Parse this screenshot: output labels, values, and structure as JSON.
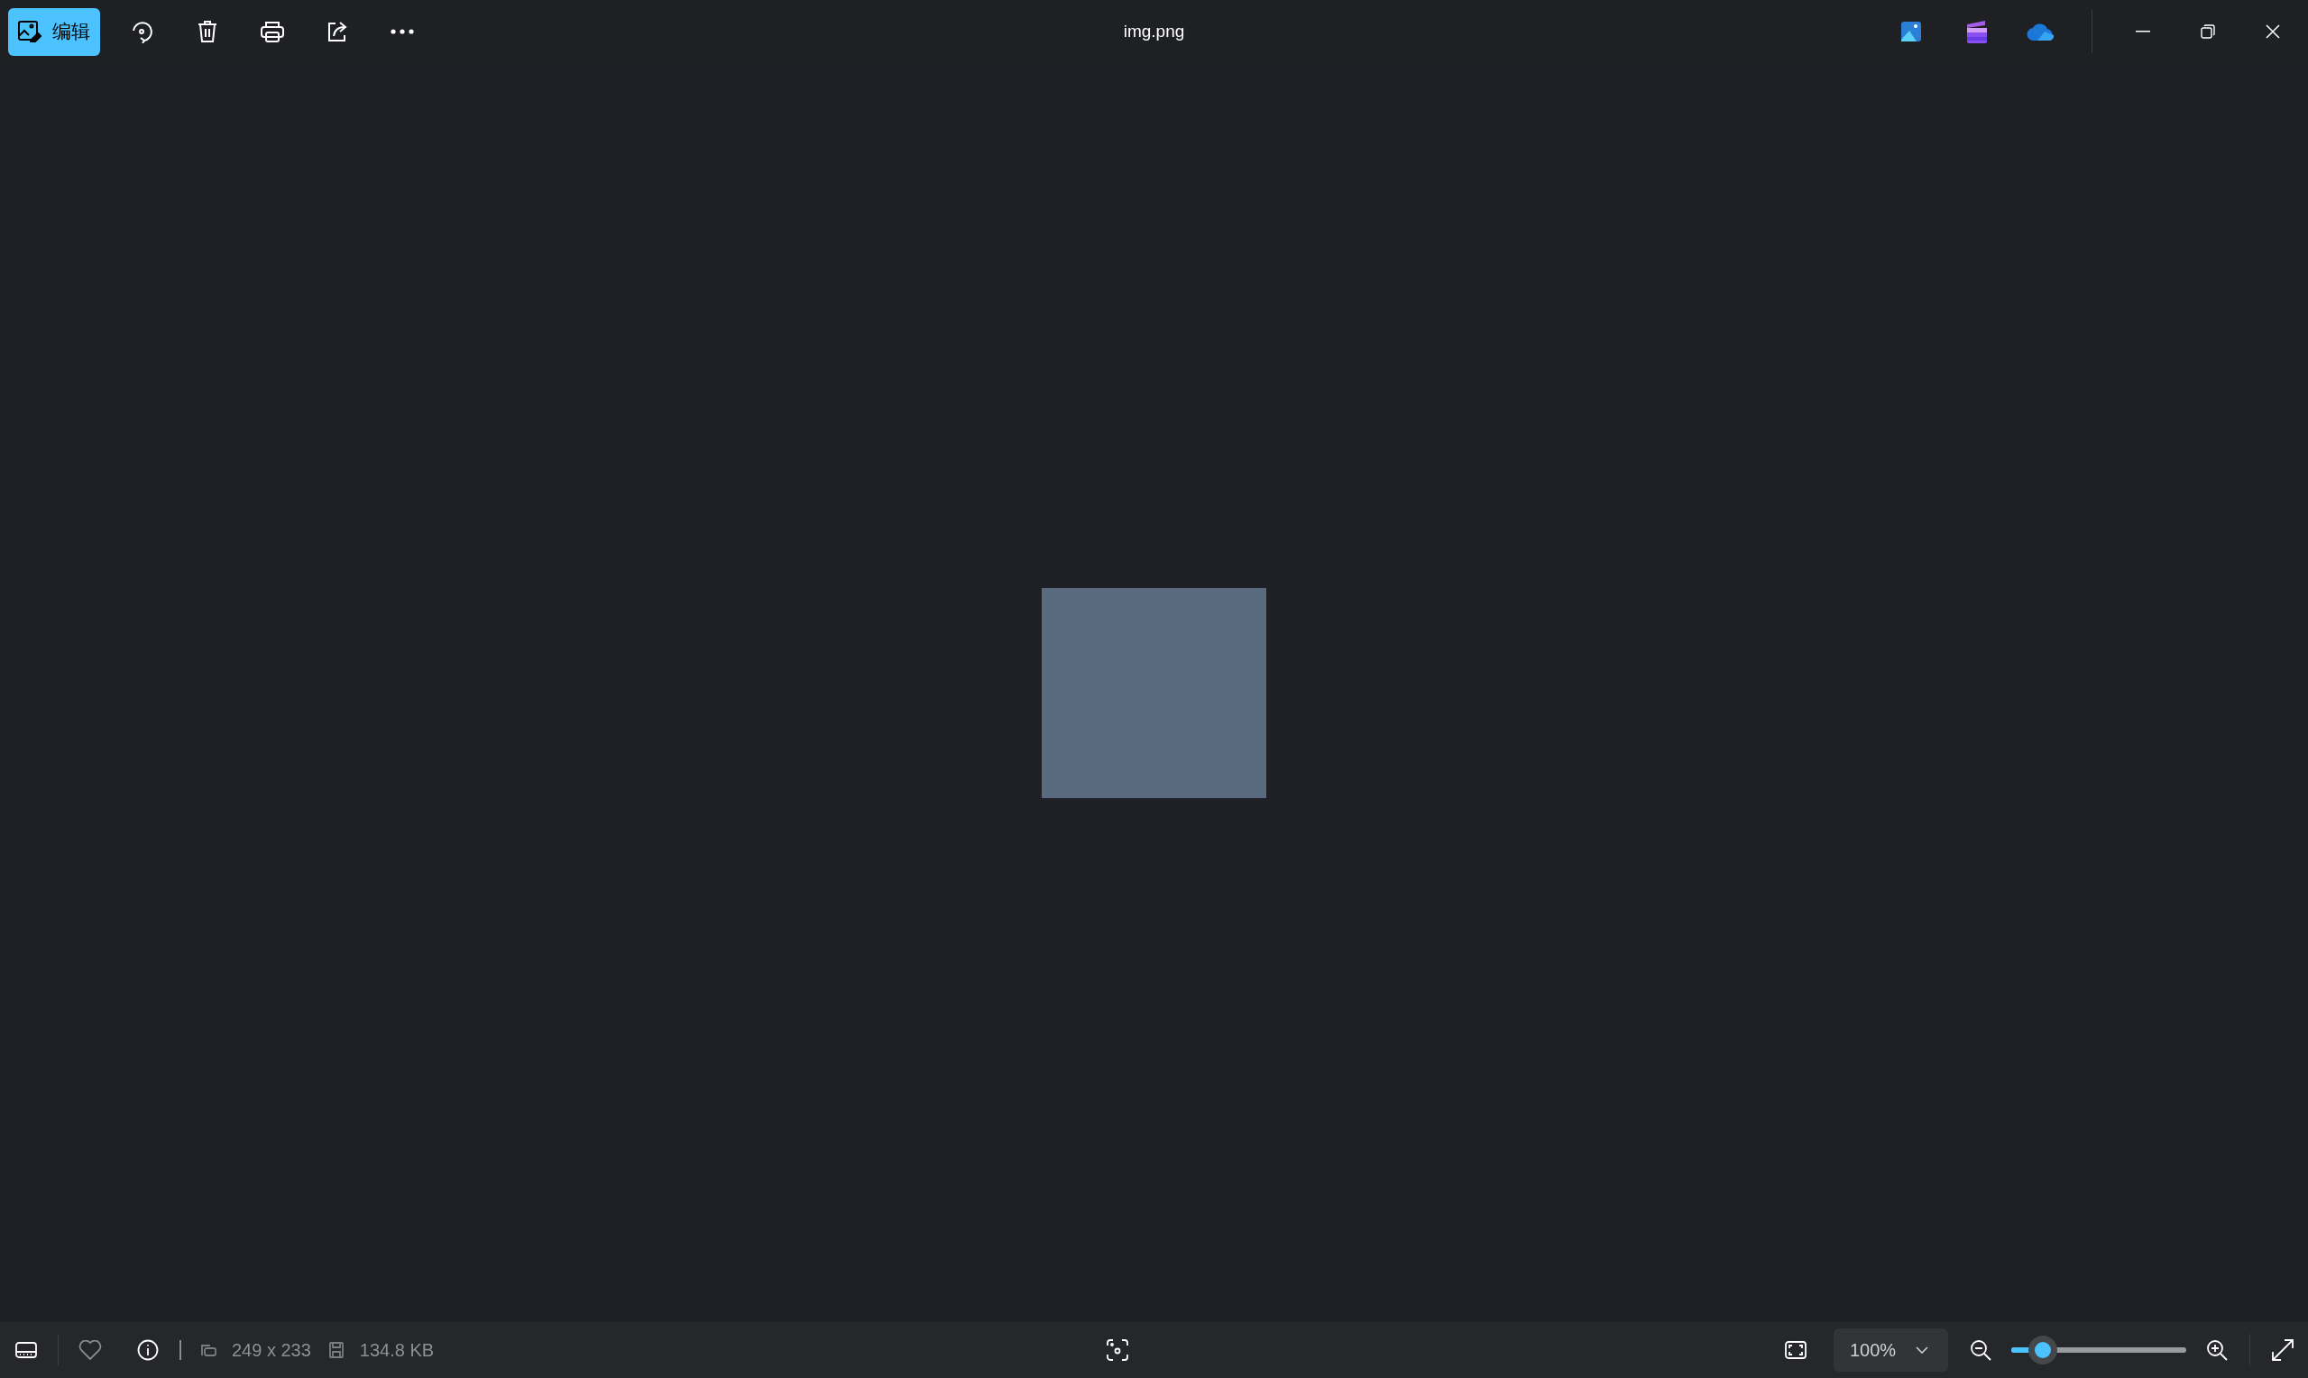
{
  "window": {
    "title": "img.png"
  },
  "toolbar": {
    "edit_button": {
      "label": "编辑",
      "selected": true
    }
  },
  "image": {
    "kind": "photo"
  },
  "status_bar": {
    "dimensions": "249 x 233",
    "file_size": "134.8 KB",
    "favorite": false,
    "zoom": "100%",
    "zoom_slider": {
      "level": 0.18
    }
  }
}
